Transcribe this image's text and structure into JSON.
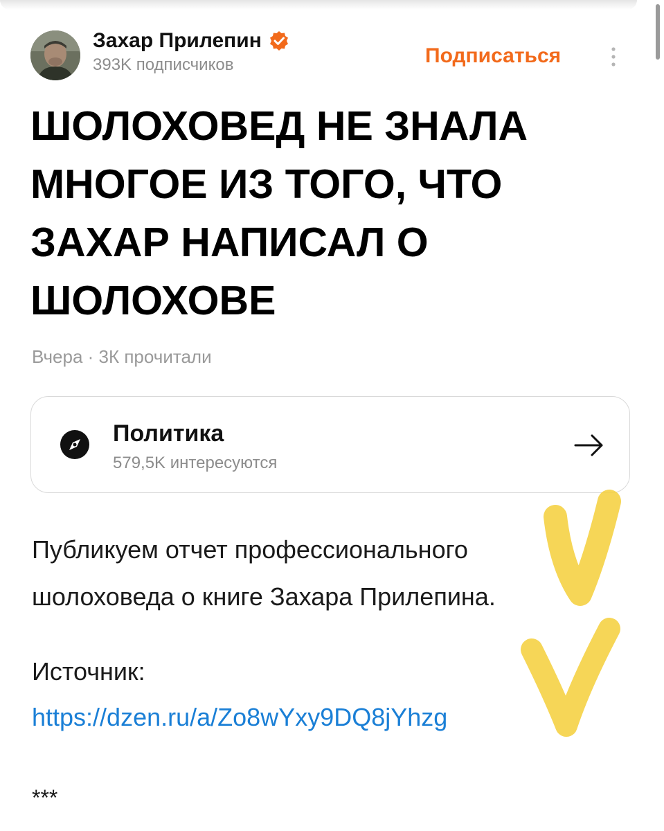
{
  "author": {
    "name": "Захар Прилепин",
    "subscribers": "393K подписчиков",
    "verified_color": "#f26a1b"
  },
  "actions": {
    "subscribe_label": "Подписаться",
    "accent_color": "#f26a1b"
  },
  "article": {
    "title": "ШОЛОХОВЕД НЕ ЗНАЛА МНОГОЕ ИЗ ТОГО, ЧТО ЗАХАР НАПИСАЛ О ШОЛОХОВЕ",
    "meta": "Вчера · 3К прочитали",
    "body": "Публикуем отчет профессионального шолоховеда о книге Захара Прилепина.",
    "source_label": "Источник:",
    "source_url": "https://dzen.ru/a/Zo8wYxy9DQ8jYhzg",
    "separator": "***"
  },
  "topic": {
    "name": "Политика",
    "interest": "579,5K интересуются"
  },
  "icons": {
    "verified": "verified-badge-icon",
    "more": "more-vertical-icon",
    "topic": "compass-icon",
    "arrow": "arrow-right-icon"
  },
  "annotations": {
    "highlighter_color": "#f5cf3a"
  }
}
